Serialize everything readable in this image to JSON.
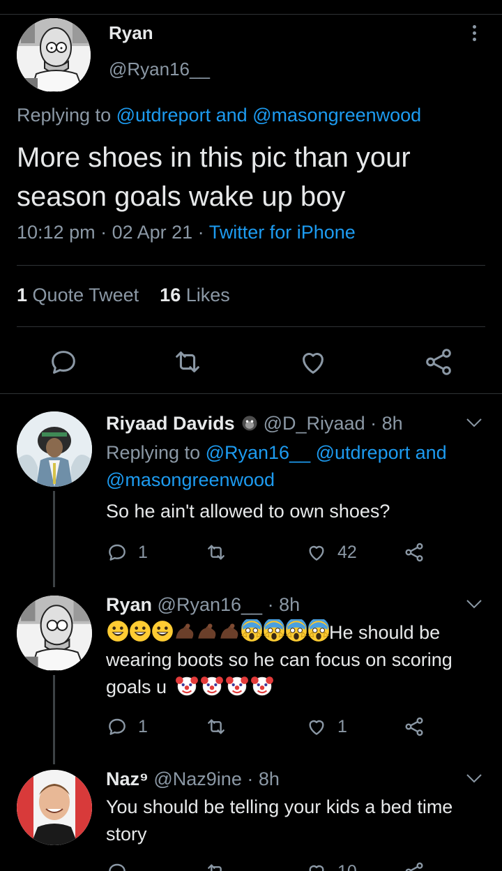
{
  "main_tweet": {
    "name": "Ryan",
    "handle": "@Ryan16__",
    "replying_prefix": "Replying to ",
    "replying_user1": "@utdreport",
    "replying_and": " and ",
    "replying_user2": "@masongreenwood",
    "text": "More shoes in this pic than your season goals wake up boy",
    "time": "10:12 pm",
    "dot1": " · ",
    "date": "02 Apr 21",
    "dot2": " · ",
    "source": "Twitter for iPhone",
    "quote_count": "1",
    "quote_label": "Quote Tweet",
    "like_count": "16",
    "like_label": "Likes",
    "icons": [
      "reply-icon",
      "retweet-icon",
      "like-icon",
      "share-icon"
    ]
  },
  "replies": [
    {
      "name": "Riyaad Davids",
      "name_emoji": "gorilla-emoji",
      "handle": "@D_Riyaad",
      "time": "· 8h",
      "replying_prefix": "Replying to ",
      "replying_user1": "@Ryan16__",
      "replying_user2": "@utdreport",
      "replying_and": " and",
      "replying_user3": "@masongreenwood",
      "text": "So he ain't allowed to own shoes?",
      "reply_count": "1",
      "retweet_count": "",
      "like_count": "42"
    },
    {
      "name": "Ryan",
      "handle": "@Ryan16__",
      "time": "· 8h",
      "text_emojis_start": [
        "grin",
        "grin",
        "grin",
        "flexed-biceps",
        "flexed-biceps",
        "flexed-biceps",
        "scream",
        "scream",
        "scream",
        "scream"
      ],
      "text_part1": "He should be wearing boots so he can focus on scoring goals u",
      "text_emojis_end": [
        "clown",
        "clown",
        "clown",
        "clown"
      ],
      "reply_count": "1",
      "retweet_count": "",
      "like_count": "1"
    },
    {
      "name": "Naz⁹",
      "handle": "@Naz9ine",
      "time": "· 8h",
      "text": "You should be telling your kids a bed time story",
      "like_count_partial": "10"
    }
  ],
  "colors": {
    "background": "#000000",
    "text": "#e7e9ea",
    "secondary": "#8b98a5",
    "link": "#1d9bf0",
    "divider": "#2f3336"
  }
}
